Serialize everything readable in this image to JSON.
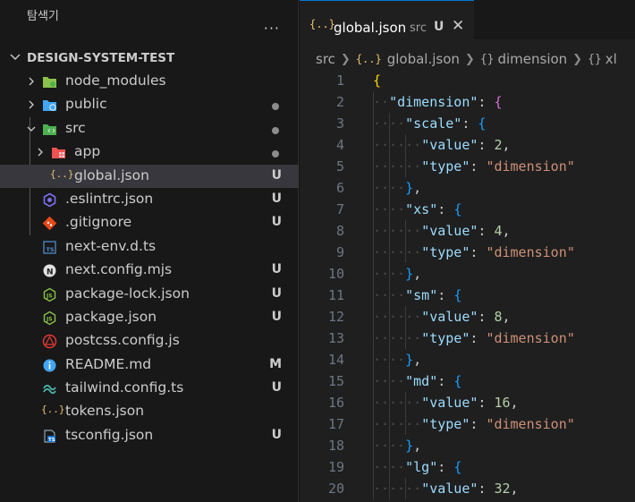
{
  "explorer": {
    "title": "탐색기",
    "more": "···",
    "root": "DESIGN-SYSTEM-TEST",
    "items": [
      {
        "name": "node_modules",
        "badge": "",
        "dot": false
      },
      {
        "name": "public",
        "badge": "",
        "dot": true
      },
      {
        "name": "src",
        "badge": "",
        "dot": true
      },
      {
        "name": "app",
        "badge": "",
        "dot": true
      },
      {
        "name": "global.json",
        "badge": "U",
        "dot": false
      },
      {
        "name": ".eslintrc.json",
        "badge": "U",
        "dot": false
      },
      {
        "name": ".gitignore",
        "badge": "U",
        "dot": false
      },
      {
        "name": "next-env.d.ts",
        "badge": "",
        "dot": false
      },
      {
        "name": "next.config.mjs",
        "badge": "U",
        "dot": false
      },
      {
        "name": "package-lock.json",
        "badge": "U",
        "dot": false
      },
      {
        "name": "package.json",
        "badge": "U",
        "dot": false
      },
      {
        "name": "postcss.config.js",
        "badge": "U",
        "dot": false
      },
      {
        "name": "README.md",
        "badge": "M",
        "dot": false
      },
      {
        "name": "tailwind.config.ts",
        "badge": "U",
        "dot": false
      },
      {
        "name": "tokens.json",
        "badge": "",
        "dot": false
      },
      {
        "name": "tsconfig.json",
        "badge": "U",
        "dot": false
      }
    ]
  },
  "tab": {
    "icon": "{..}",
    "name": "global.json",
    "desc": "src",
    "status": "U",
    "close": "✕"
  },
  "breadcrumb": {
    "folder": "src",
    "file_icon": "{..}",
    "file": "global.json",
    "sym1_icon": "{}",
    "sym1": "dimension",
    "sym2_icon": "{}",
    "sym2": "xl"
  },
  "code": {
    "line_numbers": [
      "1",
      "2",
      "3",
      "4",
      "5",
      "6",
      "7",
      "8",
      "9",
      "10",
      "11",
      "12",
      "13",
      "14",
      "15",
      "16",
      "17",
      "18",
      "19",
      "20"
    ],
    "lines": [
      "{",
      "\"dimension\": {",
      "\"scale\": {",
      "\"value\": 2,",
      "\"type\": \"dimension\"",
      "},",
      "\"xs\": {",
      "\"value\": 4,",
      "\"type\": \"dimension\"",
      "},",
      "\"sm\": {",
      "\"value\": 8,",
      "\"type\": \"dimension\"",
      "},",
      "\"md\": {",
      "\"value\": 16,",
      "\"type\": \"dimension\"",
      "},",
      "\"lg\": {",
      "\"value\": 32,"
    ]
  },
  "colors": {
    "accent": "#0078d4",
    "key": "#9cdcfe",
    "string": "#ce9178",
    "number": "#b5cea8"
  }
}
